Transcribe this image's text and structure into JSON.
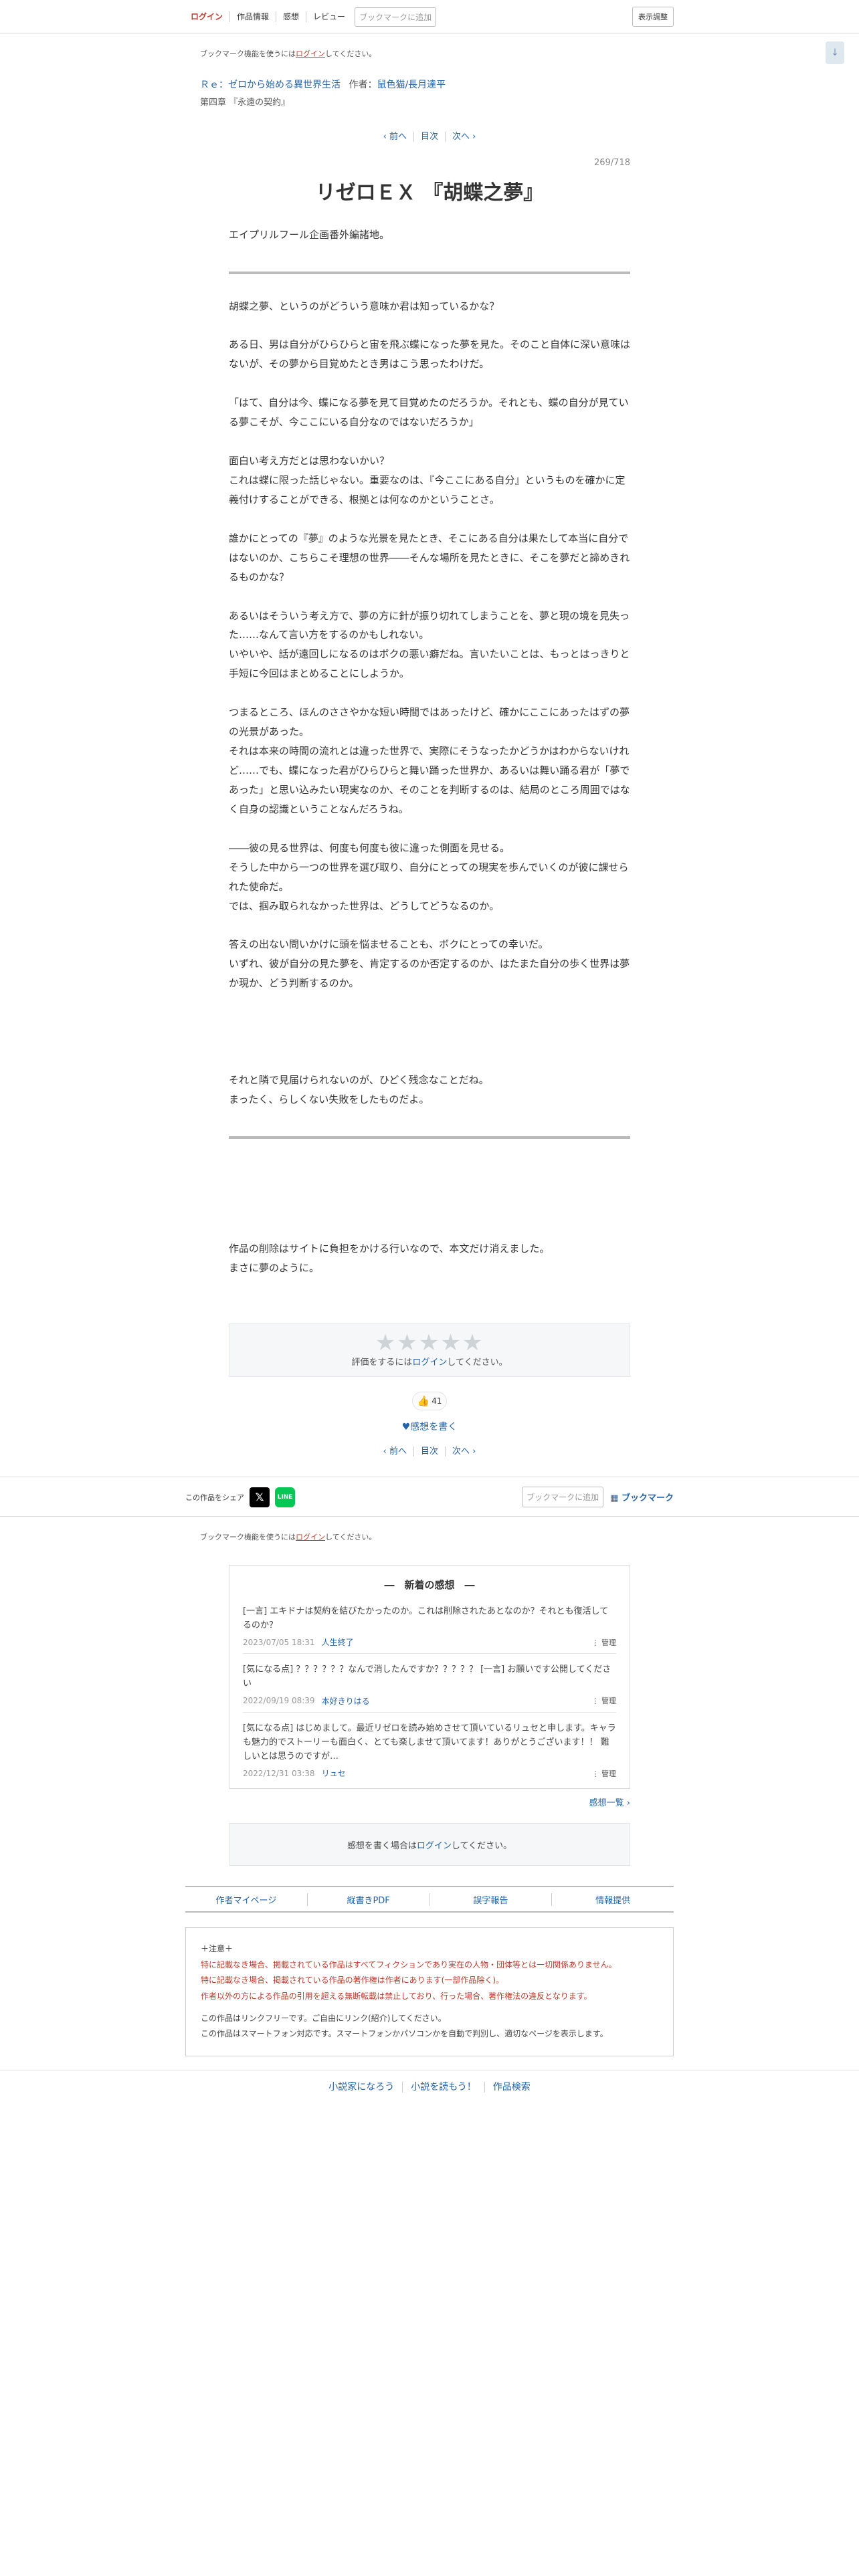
{
  "header": {
    "login": "ログイン",
    "tabs": [
      "作品情報",
      "感想",
      "レビュー"
    ],
    "bookmark_add": "ブックマークに追加",
    "display_settings": "表示調整",
    "scroll_arrow": "↓"
  },
  "bookmark_note": {
    "prefix": "ブックマーク機能を使うには",
    "link": "ログイン",
    "suffix": "してください。"
  },
  "novel": {
    "series_title": "Ｒｅ：ゼロから始める異世界生活",
    "author_label": "作者：",
    "author": "鼠色猫/長月達平",
    "chapter": "第四章 『永遠の契約』"
  },
  "pager": {
    "prev": "‹ 前へ",
    "index": "目次",
    "next": "次へ ›"
  },
  "page_number": "269/718",
  "episode": {
    "title": "リゼロＥＸ 『胡蝶之夢』",
    "preface": "エイプリルフール企画番外編諸地。",
    "paragraphs": [
      "胡蝶之夢、というのがどういう意味か君は知っているかな？",
      "",
      "ある日、男は自分がひらひらと宙を飛ぶ蝶になった夢を見た。そのこと自体に深い意味はないが、その夢から目覚めたとき男はこう思ったわけだ。",
      "",
      "「はて、自分は今、蝶になる夢を見て目覚めたのだろうか。それとも、蝶の自分が見ている夢こそが、今ここにいる自分なのではないだろうか」",
      "",
      "面白い考え方だとは思わないかい？",
      "これは蝶に限った話じゃない。重要なのは、『今ここにある自分』というものを確かに定義付けすることができる、根拠とは何なのかということさ。",
      "",
      "誰かにとっての『夢』のような光景を見たとき、そこにある自分は果たして本当に自分ではないのか、こちらこそ理想の世界――そんな場所を見たときに、そこを夢だと諦めきれるものかな？",
      "",
      "あるいはそういう考え方で、夢の方に針が振り切れてしまうことを、夢と現の境を見失った……なんて言い方をするのかもしれない。",
      "いやいや、話が遠回しになるのはボクの悪い癖だね。言いたいことは、もっとはっきりと手短に今回はまとめることにしようか。",
      "",
      "つまるところ、ほんのささやかな短い時間ではあったけど、確かにここにあったはずの夢の光景があった。",
      "それは本来の時間の流れとは違った世界で、実際にそうなったかどうかはわからないけれど……でも、蝶になった君がひらひらと舞い踊った世界か、あるいは舞い踊る君が「夢であった」と思い込みたい現実なのか、そのことを判断するのは、結局のところ周囲ではなく自身の認識ということなんだろうね。",
      "",
      "――彼の見る世界は、何度も何度も彼に違った側面を見せる。",
      "そうした中から一つの世界を選び取り、自分にとっての現実を歩んでいくのが彼に課せられた使命だ。",
      "では、掴み取られなかった世界は、どうしてどうなるのか。",
      "",
      "答えの出ない問いかけに頭を悩ませることも、ボクにとっての幸いだ。",
      "いずれ、彼が自分の見た夢を、肯定するのか否定するのか、はたまた自分の歩く世界は夢か現か、どう判断するのか。",
      "",
      "",
      "",
      "",
      "それと隣で見届けられないのが、ひどく残念なことだね。",
      "まったく、らしくない失敗をしたものだよ。"
    ],
    "afterword": [
      "作品の削除はサイトに負担をかける行いなので、本文だけ消えました。",
      "まさに夢のように。"
    ]
  },
  "rating": {
    "stars": "★★★★★",
    "note_prefix": "評価をするには",
    "note_link": "ログイン",
    "note_suffix": "してください。"
  },
  "good": {
    "icon": "👍",
    "count": "41"
  },
  "write_impression": "♥感想を書く",
  "share": {
    "label": "この作品をシェア",
    "x_icon": "𝕏",
    "line_icon": "LINE",
    "bookmark_add": "ブックマークに追加",
    "bookmark": "ブックマーク"
  },
  "reviews": {
    "heading": "―　新着の感想　―",
    "items": [
      {
        "text": "[一言] エキドナは契約を結びたかったのか。これは削除されたあとなのか？それとも復活してるのか？",
        "date": "2023/07/05 18:31",
        "user": "人生終了",
        "manage": "⋮ 管理"
      },
      {
        "text": "[気になる点] ？？？？？？なんで消したんですか？？？？？ [一言] お願いです公開してください",
        "date": "2022/09/19 08:39",
        "user": "本好きりはる",
        "manage": "⋮ 管理"
      },
      {
        "text": "[気になる点] はじめまして。最近リゼロを読み始めさせて頂いているリュセと申します。キャラも魅力的でストーリーも面白く、とても楽しませて頂いてます！ありがとうございます！！ 難しいとは思うのですが…",
        "date": "2022/12/31 03:38",
        "user": "リュセ",
        "manage": "⋮ 管理"
      }
    ],
    "more": "感想一覧 ›"
  },
  "write_box": {
    "prefix": "感想を書く場合は",
    "link": "ログイン",
    "suffix": "してください。"
  },
  "footnav": [
    "作者マイページ",
    "縦書きPDF",
    "誤字報告",
    "情報提供"
  ],
  "notice": {
    "head": "＋注意＋",
    "red_lines": [
      "特に記載なき場合、掲載されている作品はすべてフィクションであり実在の人物・団体等とは一切関係ありません。",
      "特に記載なき場合、掲載されている作品の著作権は作者にあります(一部作品除く)。",
      "作者以外の方による作品の引用を超える無断転載は禁止しており、行った場合、著作権法の違反となります。"
    ],
    "black_lines": [
      "この作品はリンクフリーです。ご自由にリンク(紹介)してください。",
      "この作品はスマートフォン対応です。スマートフォンかパソコンかを自動で判別し、適切なページを表示します。"
    ]
  },
  "bottom_links": [
    "小説家になろう",
    "小説を読もう！",
    "作品検索"
  ]
}
